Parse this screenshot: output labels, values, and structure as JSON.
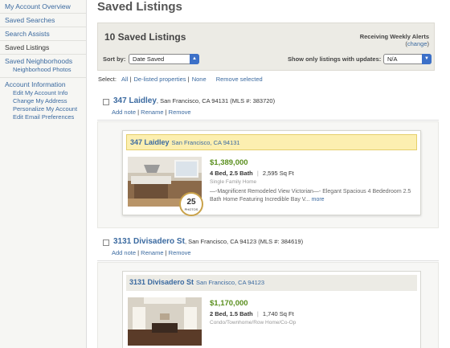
{
  "sidebar": {
    "items": [
      {
        "label": "My Account Overview"
      },
      {
        "label": "Saved Searches"
      },
      {
        "label": "Search Assists"
      },
      {
        "label": "Saved Listings"
      }
    ],
    "neighborhoods": {
      "label": "Saved Neighborhoods",
      "sub": "Neighborhood Photos"
    },
    "account": {
      "label": "Account Information",
      "subs": [
        "Edit My Account Info",
        "Change My Address",
        "Personalize My Account",
        "Edit Email Preferences"
      ]
    }
  },
  "page": {
    "title": "Saved Listings"
  },
  "header": {
    "count_title": "10 Saved Listings",
    "alerts_label": "Receiving Weekly Alerts",
    "change_open": "(",
    "change_link": "change",
    "change_close": ")",
    "sort_label": "Sort by:",
    "sort_value": "Date Saved",
    "show_only_label": "Show only listings with updates:",
    "show_only_value": "N/A"
  },
  "select_row": {
    "label": "Select:",
    "all": "All",
    "delisted": "De-listed properties",
    "none": "None",
    "remove": "Remove selected"
  },
  "listings": [
    {
      "name": "347 Laidley",
      "address": ", San Francisco, CA 94131 (MLS #: 383720)",
      "card_address": "San Francisco, CA 94131",
      "actions": {
        "add_note": "Add note",
        "rename": "Rename",
        "remove": "Remove",
        "sep": "|"
      },
      "price": "$1,389,000",
      "beds": "4 Bed, 2.5 Bath",
      "sep": "|",
      "sqft": "2,595 Sq Ft",
      "type": "Single Family Home",
      "description": "—-Magnificent Remodeled View Victorian—- Elegant Spacious 4 Bededroom 2.5 Bath Home Featuring Incredible Bay V...",
      "more": "more",
      "photos_count": "25",
      "photos_label": "PHOTOS"
    },
    {
      "name": "3131 Divisadero St",
      "address": ", San Francisco, CA 94123 (MLS #: 384619)",
      "card_address": "San Francisco, CA 94123",
      "actions": {
        "add_note": "Add note",
        "rename": "Rename",
        "remove": "Remove",
        "sep": "|"
      },
      "price": "$1,170,000",
      "beds": "2 Bed, 1.5 Bath",
      "sep": "|",
      "sqft": "1,740 Sq Ft",
      "type": "Condo/Townhome/Row Home/Co-Op"
    }
  ],
  "colors": {
    "link": "#3b6aa0",
    "price": "#5a8f1e",
    "highlight": "#fcefb0",
    "dropdown": "#3c70c8"
  }
}
